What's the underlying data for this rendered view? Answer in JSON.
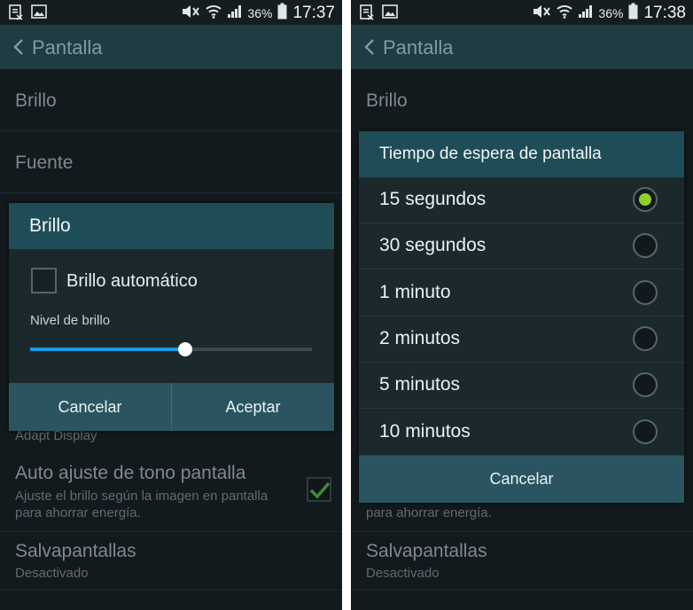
{
  "status_bar_left": {
    "battery_percent": "36%",
    "time": "17:37"
  },
  "status_bar_right": {
    "battery_percent": "36%",
    "time": "17:38"
  },
  "action_bar": {
    "title": "Pantalla"
  },
  "settings_left": {
    "brillo": "Brillo",
    "fuente": "Fuente",
    "adapt_display": "Adapt Display",
    "auto_ajuste_title": "Auto ajuste de tono pantalla",
    "auto_ajuste_sub_1": "Ajuste el brillo según la imagen en pantalla",
    "auto_ajuste_sub_2": "para ahorrar energía.",
    "auto_ajuste_checked": true,
    "salvapantallas": "Salvapantallas",
    "salvapantallas_sub": "Desactivado"
  },
  "brillo_dialog": {
    "title": "Brillo",
    "auto_brightness_label": "Brillo automático",
    "auto_brightness_checked": false,
    "level_label": "Nivel de brillo",
    "level_value": 0.55,
    "cancel_label": "Cancelar",
    "accept_label": "Aceptar"
  },
  "settings_right": {
    "brillo": "Brillo",
    "sub_tail": "para ahorrar energía.",
    "salvapantallas": "Salvapantallas",
    "salvapantallas_sub": "Desactivado"
  },
  "timeout_dialog": {
    "title": "Tiempo de espera de pantalla",
    "options": [
      {
        "label": "15 segundos",
        "selected": true
      },
      {
        "label": "30 segundos",
        "selected": false
      },
      {
        "label": "1 minuto",
        "selected": false
      },
      {
        "label": "2 minutos",
        "selected": false
      },
      {
        "label": "5 minutos",
        "selected": false
      },
      {
        "label": "10 minutos",
        "selected": false
      }
    ],
    "cancel_label": "Cancelar"
  },
  "colors": {
    "accent_blue": "#1a9ce6",
    "radio_selected": "#8fd12b",
    "check_green": "#3f8a3a",
    "header_teal": "#1f4d57"
  }
}
